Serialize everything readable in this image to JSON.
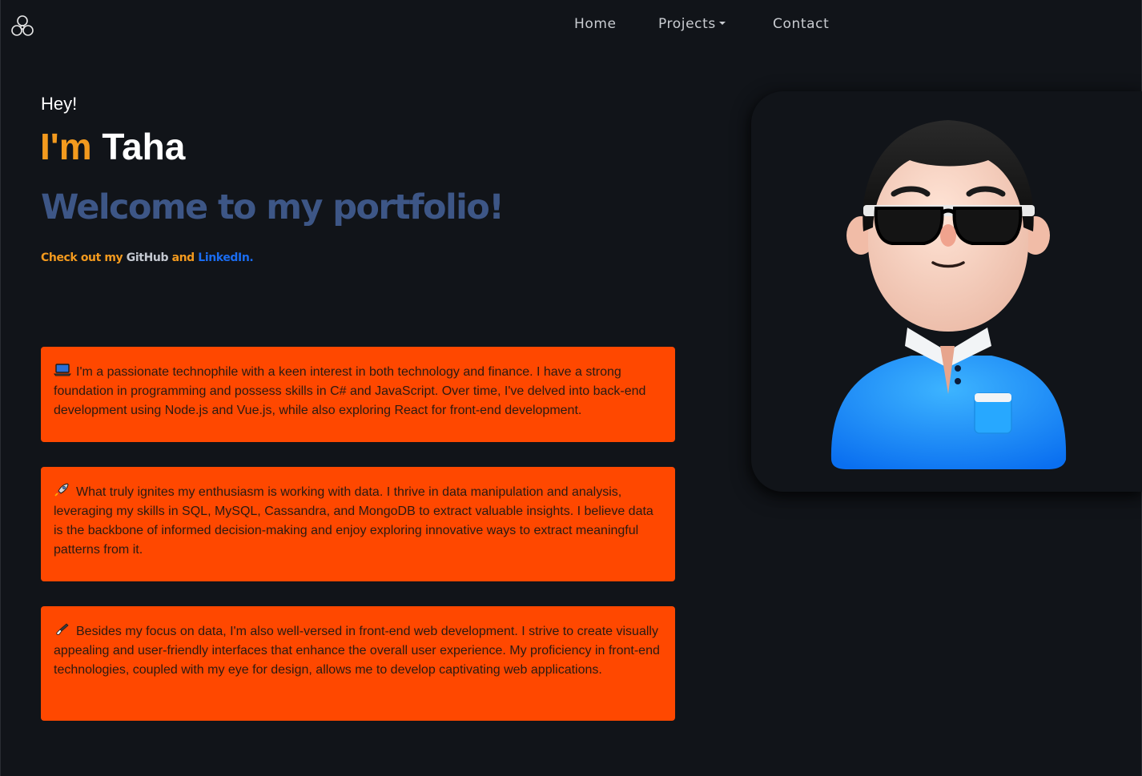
{
  "nav": {
    "home": "Home",
    "projects": "Projects",
    "contact": "Contact"
  },
  "hero": {
    "greeting": "Hey!",
    "im": "I'm",
    "name": "Taha",
    "welcome": "Welcome to my portfolio!",
    "checkout_prefix": "Check out my",
    "github": "GitHub",
    "and": "and",
    "linkedin": "LinkedIn",
    "period": "."
  },
  "cards": [
    {
      "icon": "laptop-icon",
      "text": "I'm a passionate technophile with a keen interest in both technology and finance. I have a strong foundation in programming and possess skills in C# and JavaScript. Over time, I've delved into back-end development using Node.js and Vue.js, while also exploring React for front-end development."
    },
    {
      "icon": "rocket-icon",
      "text": "What truly ignites my enthusiasm is working with data. I thrive in data manipulation and analysis, leveraging my skills in SQL, MySQL, Cassandra, and MongoDB to extract valuable insights. I believe data is the backbone of informed decision-making and enjoy exploring innovative ways to extract meaningful patterns from it."
    },
    {
      "icon": "paintbrush-icon",
      "text": "Besides my focus on data, I'm also well-versed in front-end web development. I strive to create visually appealing and user-friendly interfaces that enhance the overall user experience. My proficiency in front-end technologies, coupled with my eye for design, allows me to develop captivating web applications."
    }
  ],
  "colors": {
    "background": "#111419",
    "accent_orange": "#f39a1e",
    "card": "#ff4800",
    "welcome": "#3d5686",
    "linkedin": "#1a6cf0"
  }
}
